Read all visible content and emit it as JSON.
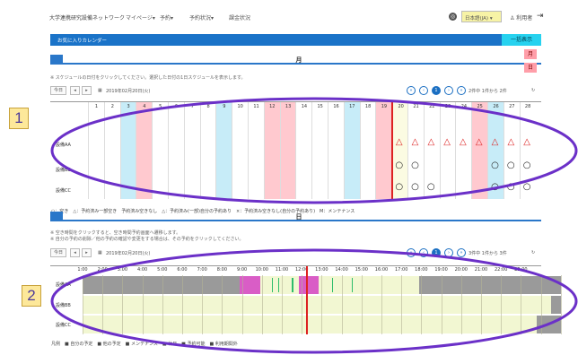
{
  "header": {
    "brand": "大学連携研究設備ネットワーク",
    "nav": [
      "マイページ▾",
      "予約▾",
      "予約状況▾",
      "課金状況"
    ],
    "language": "日本語(JA) ▾",
    "user": "利用者"
  },
  "favorites": {
    "label": "お気に入りカレンダー",
    "button": "一括表示"
  },
  "month": {
    "section_title": "月",
    "side_tabs": [
      "月",
      "日"
    ],
    "note": "※ スケジュールの日付をクリックしてください。選択した日付の1日スケジュールを表示します。",
    "today_label": "今日",
    "date_label": "2019年02月20日(火)",
    "pages": [
      "1"
    ],
    "result_text": "2件中 1件から 2件",
    "days": [
      "1",
      "2",
      "3",
      "4",
      "5",
      "6",
      "7",
      "8",
      "9",
      "10",
      "11",
      "12",
      "13",
      "14",
      "15",
      "16",
      "17",
      "18",
      "19",
      "20",
      "21",
      "22",
      "23",
      "24",
      "25",
      "26",
      "27",
      "28"
    ],
    "equipment": [
      "設備AA",
      "設備BB",
      "設備CC"
    ],
    "availability_marks": {
      "AA": [
        "20:△",
        "21:△",
        "22:△",
        "23:△",
        "24:△",
        "25:△",
        "26:△",
        "27:△",
        "28:△"
      ],
      "BB": [
        "20:○",
        "21:○",
        "26:○",
        "27:○",
        "28:○"
      ],
      "CC": [
        "20:○",
        "21:○",
        "22:○",
        "26:○",
        "27:○",
        "28:○"
      ]
    },
    "legend": "○：空き　△：予約済み一部空き　予約済み空きなし　△：予約済み(一部)自分の予約あり　×：予約済み空きなし(自分の予約あり)　M：メンテナンス"
  },
  "day": {
    "section_title": "日",
    "notes": [
      "※ 空き時間をクリックすると、空き時間予約画面へ遷移します。",
      "※ 自分の予約の削除／他の予約の確認や変更をする場合は、その予約をクリックしてください。"
    ],
    "today_label": "今日",
    "date_label": "2019年02月20日(火)",
    "pages": [
      "1"
    ],
    "result_text": "3件中 1件から 3件",
    "hours": [
      "1:00",
      "2:00",
      "3:00",
      "4:00",
      "5:00",
      "6:00",
      "7:00",
      "8:00",
      "9:00",
      "10:00",
      "11:00",
      "12:00",
      "13:00",
      "14:00",
      "15:00",
      "16:00",
      "17:00",
      "18:00",
      "19:00",
      "20:00",
      "21:00",
      "22:00",
      "23:00"
    ],
    "equipment": [
      "設備AA",
      "設備BB",
      "設備CC"
    ],
    "legend": "凡例　■ 自分の予定　■ 他の予定　■ メンテナンス　■ 休日　■ 予約可能　■ 利用期間外"
  },
  "callouts": [
    "1",
    "2"
  ],
  "colors": {
    "blue": "#1a73c8",
    "cyan": "#27d2ef",
    "pink": "#ffc9cf",
    "lightblue": "#c7ecf8",
    "magenta": "#d95dc6",
    "green": "#2ebd6b",
    "gray": "#9a9a9a",
    "paleyellow": "#f2f7d2",
    "ellipse": "#6b30c8"
  }
}
